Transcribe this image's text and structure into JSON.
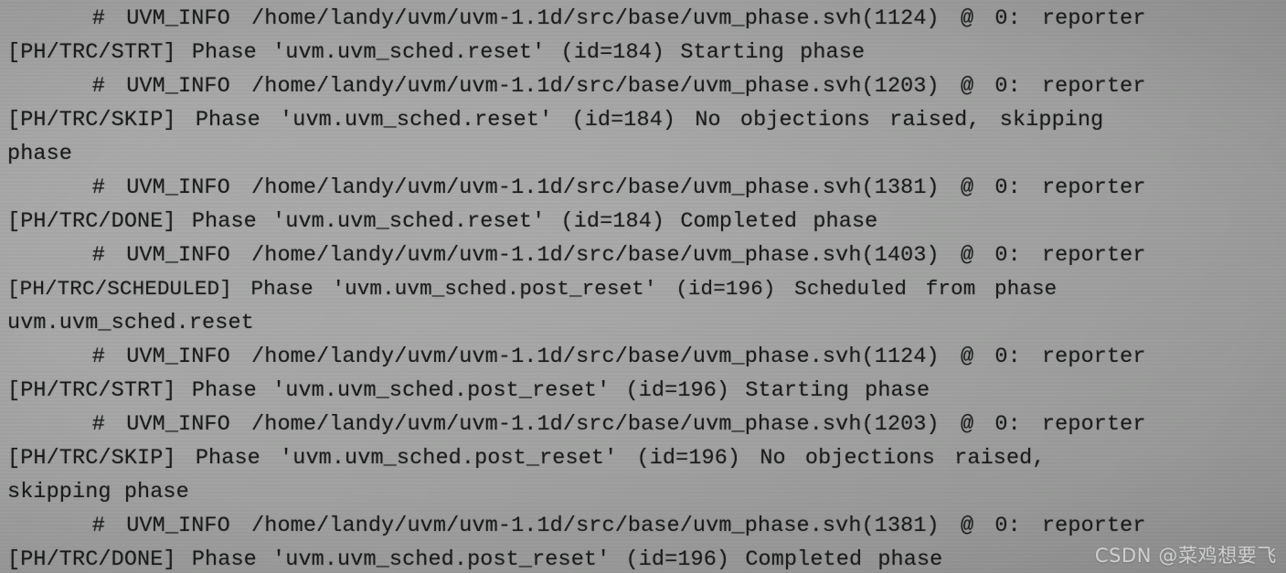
{
  "terminal": {
    "background_color": "#a2a3a2",
    "text_color": "#191a1b",
    "lines": [
      "    # UVM_INFO /home/landy/uvm/uvm-1.1d/src/base/uvm_phase.svh(1124) @ 0: reporter",
      "[PH/TRC/STRT] Phase 'uvm.uvm_sched.reset' (id=184) Starting phase",
      "    # UVM_INFO /home/landy/uvm/uvm-1.1d/src/base/uvm_phase.svh(1203) @ 0: reporter",
      "[PH/TRC/SKIP] Phase 'uvm.uvm_sched.reset' (id=184) No objections raised, skipping",
      "phase",
      "    # UVM_INFO /home/landy/uvm/uvm-1.1d/src/base/uvm_phase.svh(1381) @ 0: reporter",
      "[PH/TRC/DONE] Phase 'uvm.uvm_sched.reset' (id=184) Completed phase",
      "    # UVM_INFO /home/landy/uvm/uvm-1.1d/src/base/uvm_phase.svh(1403) @ 0: reporter",
      "[PH/TRC/SCHEDULED] Phase 'uvm.uvm_sched.post_reset' (id=196) Scheduled from phase",
      "uvm.uvm_sched.reset",
      "    # UVM_INFO /home/landy/uvm/uvm-1.1d/src/base/uvm_phase.svh(1124) @ 0: reporter",
      "[PH/TRC/STRT] Phase 'uvm.uvm_sched.post_reset' (id=196) Starting phase",
      "    # UVM_INFO /home/landy/uvm/uvm-1.1d/src/base/uvm_phase.svh(1203) @ 0: reporter",
      "[PH/TRC/SKIP] Phase 'uvm.uvm_sched.post_reset' (id=196) No objections raised,",
      "skipping phase",
      "    # UVM_INFO /home/landy/uvm/uvm-1.1d/src/base/uvm_phase.svh(1381) @ 0: reporter",
      "[PH/TRC/DONE] Phase 'uvm.uvm_sched.post_reset' (id=196) Completed phase"
    ]
  },
  "watermark": {
    "text": "CSDN @菜鸡想要飞",
    "color": "#d8dad9"
  }
}
